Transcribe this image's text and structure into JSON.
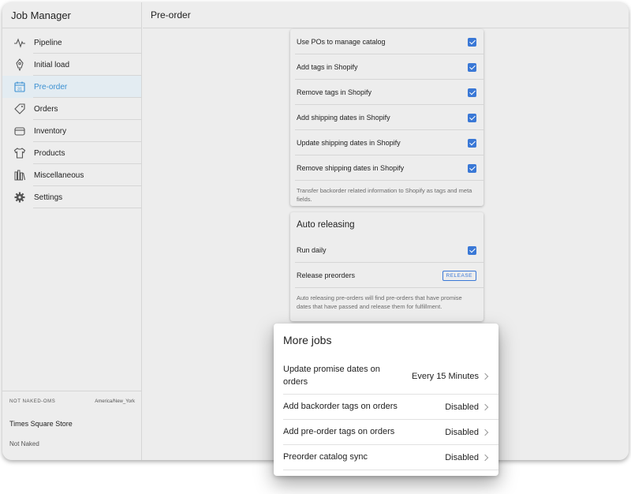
{
  "app": {
    "title": "Job Manager"
  },
  "sidebar": {
    "items": [
      {
        "label": "Pipeline",
        "icon": "pulse-icon"
      },
      {
        "label": "Initial load",
        "icon": "rocket-icon"
      },
      {
        "label": "Pre-order",
        "icon": "calendar-icon",
        "active": true
      },
      {
        "label": "Orders",
        "icon": "tag-icon"
      },
      {
        "label": "Inventory",
        "icon": "archive-icon"
      },
      {
        "label": "Products",
        "icon": "shirt-icon"
      },
      {
        "label": "Miscellaneous",
        "icon": "library-icon"
      },
      {
        "label": "Settings",
        "icon": "gear-icon"
      }
    ],
    "footer": {
      "instance": "NOT NAKED-OMS",
      "timezone": "America/New_York",
      "store": "Times Square Store",
      "store_sub": "Not Naked"
    }
  },
  "main": {
    "title": "Pre-order",
    "shopify_card": {
      "rows": [
        {
          "label": "Use POs to manage catalog",
          "checked": true
        },
        {
          "label": "Add tags in Shopify",
          "checked": true
        },
        {
          "label": "Remove tags in Shopify",
          "checked": true
        },
        {
          "label": "Add shipping dates in Shopify",
          "checked": true
        },
        {
          "label": "Update shipping dates in Shopify",
          "checked": true
        },
        {
          "label": "Remove shipping dates in Shopify",
          "checked": true
        }
      ],
      "note": "Transfer backorder related information to Shopify as tags and meta fields."
    },
    "auto_release_card": {
      "title": "Auto releasing",
      "run_daily_label": "Run daily",
      "run_daily_checked": true,
      "release_label": "Release preorders",
      "release_button": "RELEASE",
      "note": "Auto releasing pre-orders will find pre-orders that have promise dates that have passed and release them for fulfillment."
    },
    "more_jobs": {
      "title": "More jobs",
      "jobs": [
        {
          "label": "Update promise dates on orders",
          "value": "Every 15 Minutes"
        },
        {
          "label": "Add backorder tags on orders",
          "value": "Disabled"
        },
        {
          "label": "Add pre-order tags on orders",
          "value": "Disabled"
        },
        {
          "label": "Preorder catalog sync",
          "value": "Disabled"
        }
      ]
    }
  },
  "colors": {
    "accent": "#3a78d6",
    "active_bg": "#e3ecf2",
    "active_text": "#3a8fd1"
  }
}
